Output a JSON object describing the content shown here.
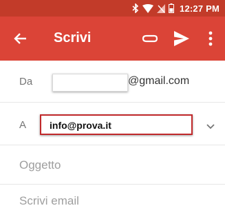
{
  "status_bar": {
    "time": "12:27 PM",
    "icons": [
      "bluetooth-icon",
      "wifi-icon",
      "no-sim-icon",
      "battery-icon"
    ]
  },
  "app_bar": {
    "title": "Scrivi",
    "icons": [
      "back-arrow-icon",
      "attach-icon",
      "send-icon",
      "more-vert-icon"
    ]
  },
  "from": {
    "label": "Da",
    "domain": "@gmail.com"
  },
  "to": {
    "label": "A",
    "value": "info@prova.it"
  },
  "subject": {
    "placeholder": "Oggetto"
  },
  "body": {
    "placeholder": "Scrivi email"
  },
  "colors": {
    "status_bar": "#c23b29",
    "app_bar": "#db4437",
    "highlight": "#c0282a"
  }
}
